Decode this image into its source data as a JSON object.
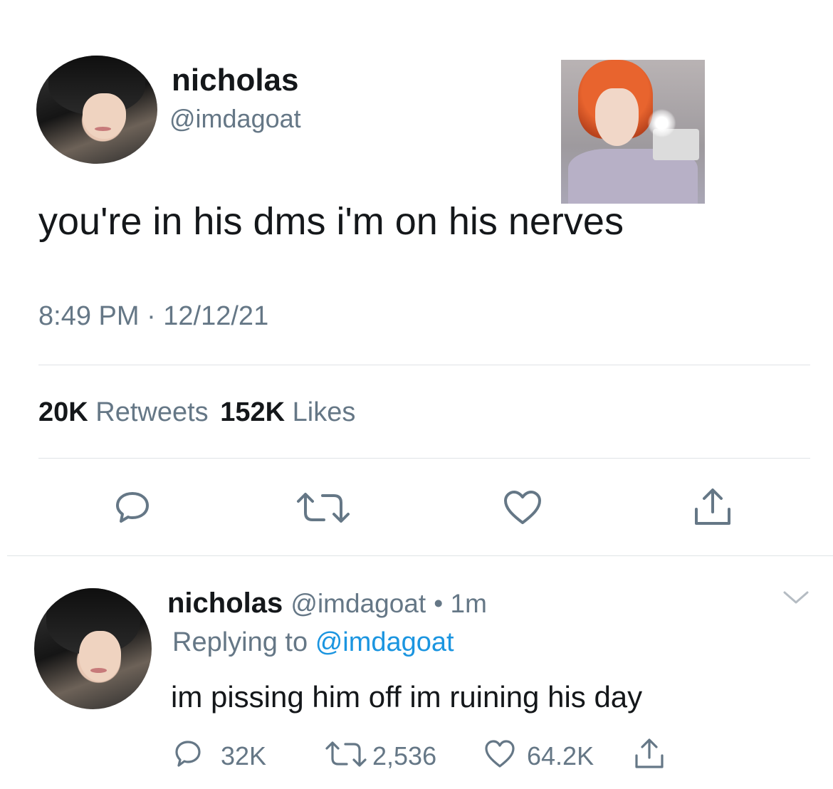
{
  "tweet": {
    "display_name": "nicholas",
    "handle": "@imdagoat",
    "text": "you're in his dms i'm on his nerves",
    "timestamp": "8:49 PM · 12/12/21",
    "stats": {
      "retweets_count": "20K",
      "retweets_label": "Retweets",
      "likes_count": "152K",
      "likes_label": "Likes"
    },
    "actions": [
      "reply-icon",
      "retweet-icon",
      "like-icon",
      "share-icon"
    ]
  },
  "reply": {
    "display_name": "nicholas",
    "handle": "@imdagoat",
    "time": "• 1m",
    "replying_prefix": "Replying to",
    "replying_to": "@imdagoat",
    "text": "im pissing him off im ruining his day",
    "counts": {
      "replies": "32K",
      "retweets": "2,536",
      "likes": "64.2K"
    }
  },
  "colors": {
    "text": "#14171a",
    "muted": "#657786",
    "link": "#1b95e0",
    "divider": "#dfe3e6"
  }
}
